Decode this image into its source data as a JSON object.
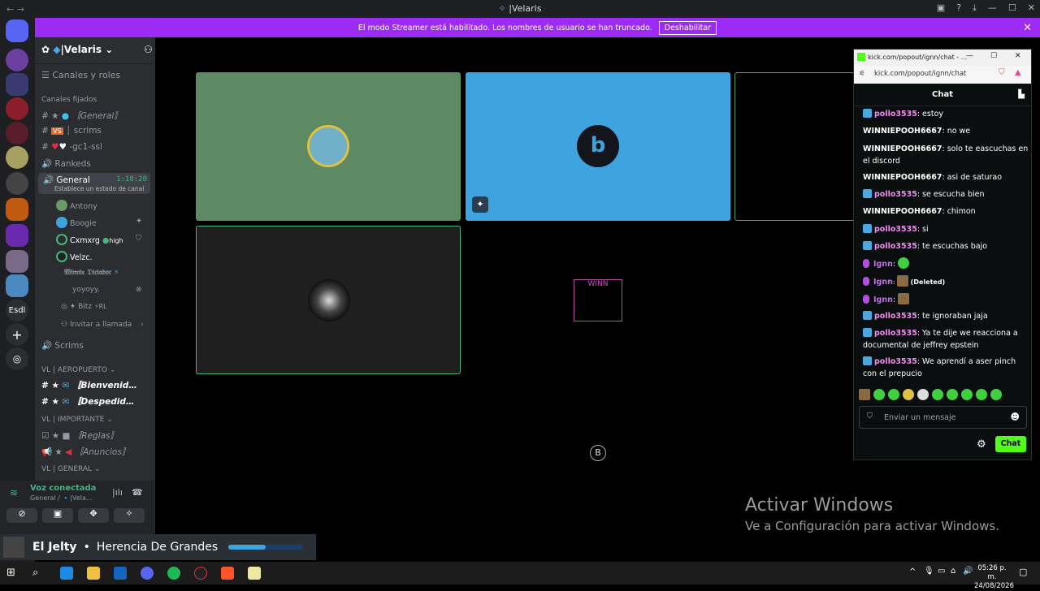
{
  "window": {
    "title": "|Velaris",
    "nav_back": "←",
    "nav_forward": "→"
  },
  "banner": {
    "text": "El modo Streamer está habilitado. Los nombres de usuario se han truncado.",
    "button": "Deshabilitar",
    "close": "✕"
  },
  "server": {
    "name": "|Velaris",
    "channels_roles": "Canales y roles",
    "pinned_header": "Canales fijados",
    "channels": [
      {
        "prefix": "# ★",
        "label": "〚General〛",
        "italic": true
      },
      {
        "prefix": "#",
        "label": "┆ scrims"
      },
      {
        "prefix": "#",
        "label": "-gc1-ssl"
      },
      {
        "prefix": "🔊",
        "label": "Rankeds"
      }
    ],
    "active_voice": {
      "label": "General",
      "timer": "1:18:20",
      "status": "Establece un estado de canal"
    },
    "voice_members": [
      {
        "name": "Antony"
      },
      {
        "name": "Boogie"
      },
      {
        "name": "Cxmxrg",
        "tag": "high"
      },
      {
        "name": "Velzc."
      },
      {
        "name": "𝔚𝔦𝔫𝔫𝔦𝔢 𝔇𝔦𝔠𝔱𝔞𝔡𝔬𝔯"
      },
      {
        "name": "yoyoyy."
      },
      {
        "name": "✦ Bitz",
        "tag": "RL"
      }
    ],
    "invite": "Invitar a llamada",
    "scrims_voice": "Scrims",
    "categories": [
      {
        "label": "VL | AEROPUERTO",
        "items": [
          "〚Bienvenid…",
          "〚Despedid…"
        ]
      },
      {
        "label": "VL | IMPORTANTE",
        "items": [
          "〚Reglas〛",
          "〚Anuncios〛"
        ]
      },
      {
        "label": "VL | GENERAL",
        "items": []
      }
    ]
  },
  "voice_panel": {
    "status": "Voz conectada",
    "sub": "General / 🔹|Vela..."
  },
  "rail": {
    "label_esdl": "Esdl"
  },
  "kick": {
    "url_title": "kick.com/popout/ignn/chat - ...",
    "address": "kick.com/popout/ignn/chat",
    "header": "Chat",
    "messages": [
      {
        "user": "pollo3535",
        "text": "estoy",
        "kind": "badge"
      },
      {
        "user": "WINNIEPOOH6667",
        "text": "no we",
        "kind": "plain"
      },
      {
        "user": "WINNIEPOOH6667",
        "text": "solo te eascuchas en el discord",
        "kind": "plain"
      },
      {
        "user": "WINNIEPOOH6667",
        "text": "asi de saturao",
        "kind": "plain"
      },
      {
        "user": "pollo3535",
        "text": "se escucha bien",
        "kind": "badge"
      },
      {
        "user": "WINNIEPOOH6667",
        "text": "chimon",
        "kind": "plain"
      },
      {
        "user": "pollo3535",
        "text": "si",
        "kind": "badge"
      },
      {
        "user": "pollo3535",
        "text": "te escuchas bajo",
        "kind": "badge"
      },
      {
        "user": "Ignn",
        "text": "",
        "kind": "mic"
      },
      {
        "user": "Ignn",
        "text": "(Deleted)",
        "kind": "mic"
      },
      {
        "user": "Ignn",
        "text": "",
        "kind": "mic"
      },
      {
        "user": "pollo3535",
        "text": "te ignoraban jaja",
        "kind": "badge"
      },
      {
        "user": "pollo3535",
        "text": "Ya te dije we reacciona a documental de jeffrey epstein",
        "kind": "badge"
      },
      {
        "user": "pollo3535",
        "text": "We aprendí a aser pinch con el prepucio",
        "kind": "badge"
      }
    ],
    "input_placeholder": "Enviar un mensaje",
    "send_button": "Chat"
  },
  "watermark": {
    "title": "Activar Windows",
    "sub": "Ve a Configuración para activar Windows."
  },
  "now_playing": {
    "artist": "El Jelty",
    "separator": "•",
    "track": "Herencia De Grandes",
    "progress": 0.5
  },
  "taskbar": {
    "time": "05:26 p. m.",
    "date": "24/08/2026"
  },
  "colors": {
    "banner": "#9c2cf3",
    "tile_green": "#5e8a63",
    "tile_blue": "#3ea4e0",
    "kick_green": "#53fc18",
    "speaking_green": "#43b581"
  }
}
